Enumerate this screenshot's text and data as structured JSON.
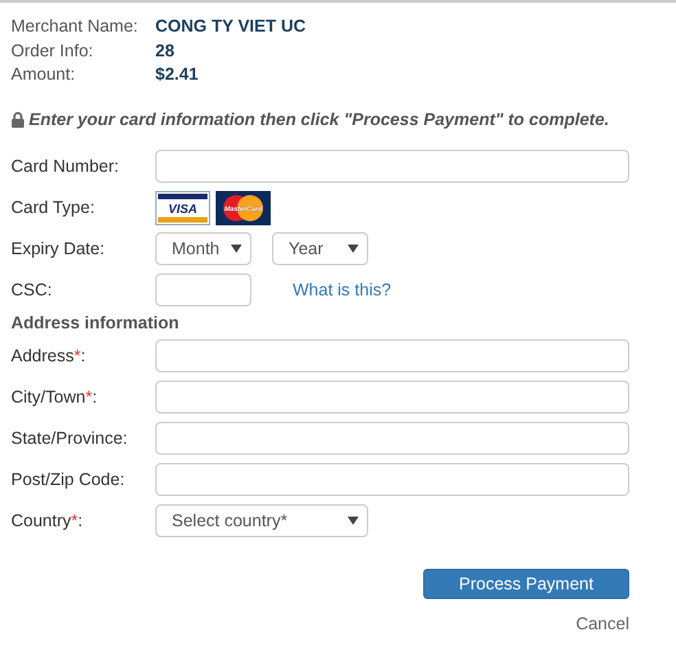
{
  "merchant": [
    {
      "label": "Merchant Name:",
      "value": "CONG TY VIET UC"
    },
    {
      "label": "Order Info:",
      "value": "28"
    },
    {
      "label": "Amount:",
      "value": "$2.41"
    }
  ],
  "instruction": "Enter your card information then click \"Process Payment\" to complete.",
  "card_fields": [
    {
      "kind": "input",
      "label": "Card Number:"
    },
    {
      "kind": "cards",
      "label": "Card Type:",
      "cards": [
        {
          "kind": "visa",
          "text": "VISA"
        },
        {
          "kind": "mastercard",
          "text": "MasterCard"
        }
      ]
    },
    {
      "kind": "selects",
      "label": "Expiry Date:",
      "selects": [
        {
          "value": "Month"
        },
        {
          "value": "Year"
        }
      ]
    },
    {
      "kind": "short",
      "label": "CSC:",
      "link": "What is this?"
    }
  ],
  "address_heading": "Address information",
  "address_fields": [
    {
      "kind": "input",
      "label": "Address",
      "required_mark": "*",
      "label_end": ":"
    },
    {
      "kind": "input",
      "label": "City/Town",
      "required_mark": "*",
      "label_end": ":"
    },
    {
      "kind": "input",
      "label": "State/Province:"
    },
    {
      "kind": "input",
      "label": "Post/Zip Code:"
    },
    {
      "kind": "select",
      "label": "Country",
      "required_mark": "*",
      "label_end": ":",
      "value": "Select country*"
    }
  ],
  "submit": "Process Payment",
  "cancel": "Cancel"
}
